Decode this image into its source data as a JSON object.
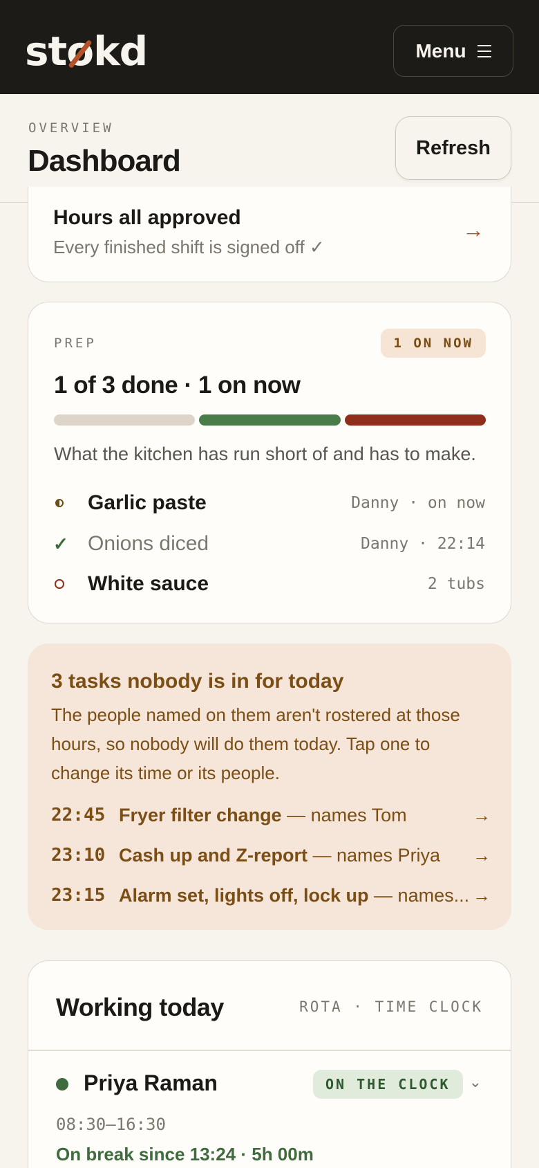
{
  "app": {
    "logo": "stokd",
    "menu_label": "Menu"
  },
  "header": {
    "eyebrow": "OVERVIEW",
    "title": "Dashboard",
    "refresh_label": "Refresh"
  },
  "approved": {
    "title": "Hours all approved",
    "subtitle": "Every finished shift is signed off ✓"
  },
  "prep": {
    "eyebrow": "PREP",
    "badge": "1 ON NOW",
    "headline": "1 of 3 done · 1 on now",
    "progress": {
      "done": 1,
      "on_now": 1,
      "total": 3
    },
    "description": "What the kitchen has run short of and has to make.",
    "tasks": [
      {
        "name": "Garlic paste",
        "meta": "Danny · on now",
        "status": "on-now"
      },
      {
        "name": "Onions diced",
        "meta": "Danny · 22:14",
        "status": "done"
      },
      {
        "name": "White sauce",
        "meta": "2 tubs",
        "status": "todo"
      }
    ]
  },
  "unassigned": {
    "title": "3 tasks nobody is in for today",
    "body": "The people named on them aren't rostered at those hours, so nobody will do them today. Tap one to change its time or its people.",
    "rows": [
      {
        "time": "22:45",
        "task": "Fryer filter change",
        "names": " — names Tom"
      },
      {
        "time": "23:10",
        "task": "Cash up and Z-report",
        "names": " — names Priya"
      },
      {
        "time": "23:15",
        "task": "Alarm set, lights off, lock up",
        "names": " — names..."
      }
    ]
  },
  "working": {
    "title": "Working today",
    "meta": "ROTA · TIME CLOCK",
    "people": [
      {
        "name": "Priya Raman",
        "badge": "ON THE CLOCK",
        "hours": "08:30–16:30",
        "status": "On break since 13:24 · 5h 00m"
      }
    ]
  },
  "colors": {
    "accent": "#b4532a",
    "done": "#4a7c4a",
    "on_now": "#8e2e1b",
    "warning_bg": "#f6e6d9"
  }
}
